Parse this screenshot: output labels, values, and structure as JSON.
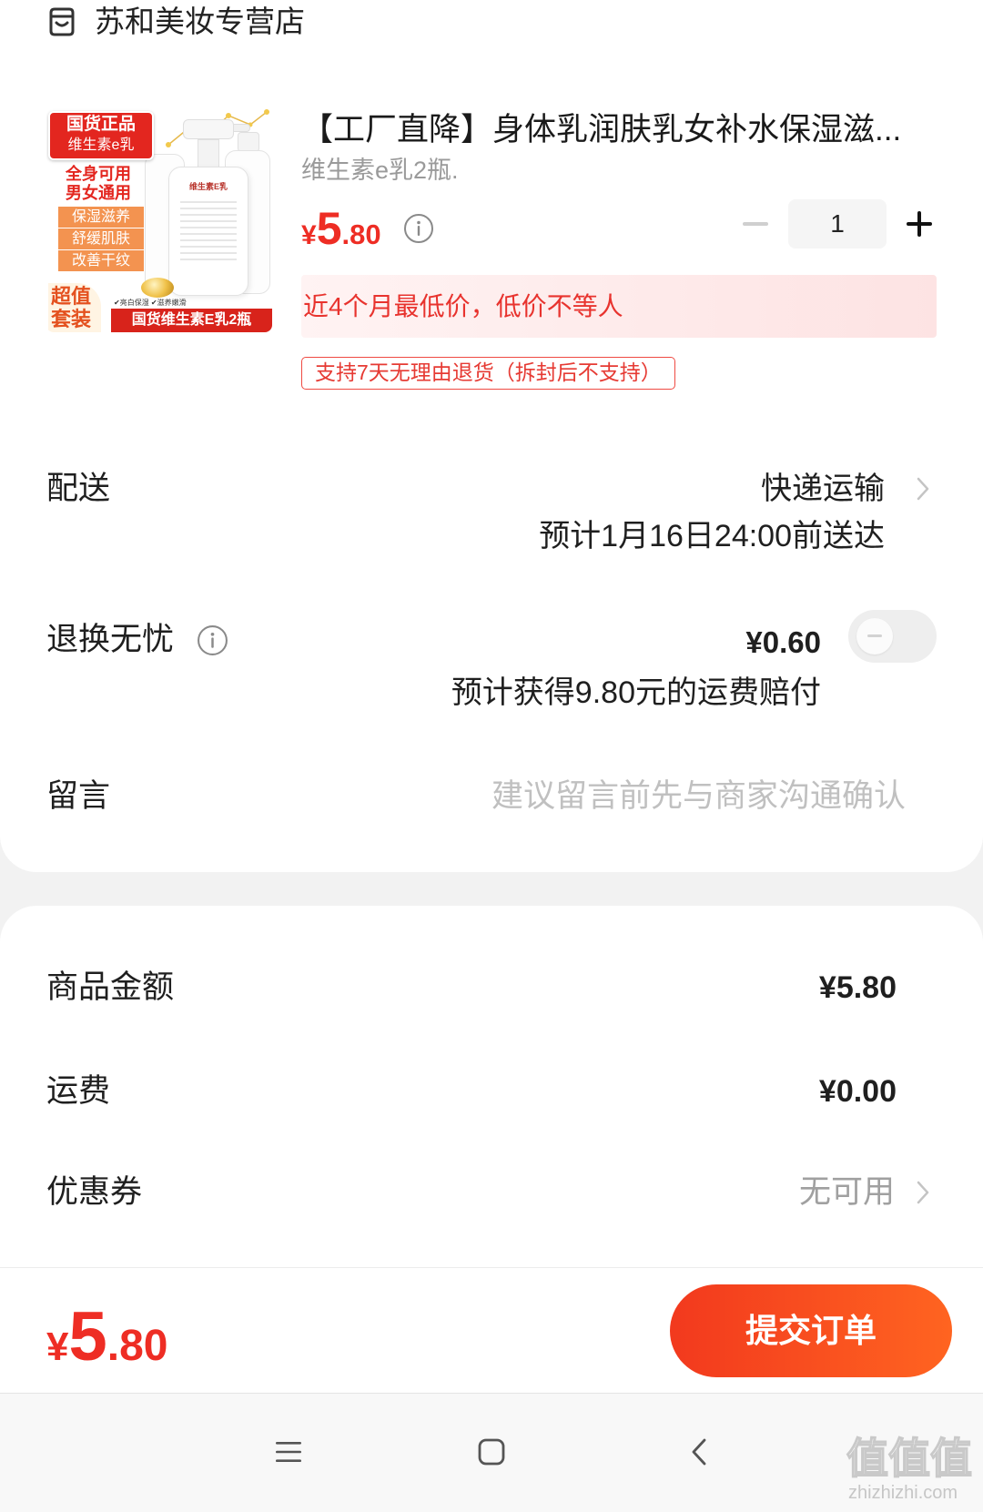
{
  "store": {
    "name": "苏和美妆专营店",
    "icon": "store-icon"
  },
  "product": {
    "title": "【工厂直降】身体乳润肤乳女补水保湿滋...",
    "spec": "维生素e乳2瓶.",
    "price": {
      "symbol": "¥",
      "integer": "5",
      "decimal": ".80"
    },
    "quantity": "1",
    "promo_banner": "近4个月最低价，低价不等人",
    "return_tag": "支持7天无理由退货（拆封后不支持）",
    "image": {
      "badge_line1": "国货正品",
      "badge_line2": "维生素e乳",
      "usage_line1": "全身可用",
      "usage_line2": "男女通用",
      "benefits": [
        "保湿滋养",
        "舒缓肌肤",
        "改善干纹"
      ],
      "bundle_line1": "超值",
      "bundle_line2": "套装",
      "checks": "✔亮白保湿 ✔滋养嫩滑",
      "bottom_banner": "国货维生素E乳2瓶",
      "bottle_label": "维生素E乳"
    }
  },
  "delivery": {
    "label": "配送",
    "method": "快递运输",
    "eta": "预计1月16日24:00前送达"
  },
  "return_insurance": {
    "label": "退换无忧",
    "price": "¥0.60",
    "note": "预计获得9.80元的运费赔付",
    "enabled": false
  },
  "message": {
    "label": "留言",
    "placeholder": "建议留言前先与商家沟通确认"
  },
  "summary": {
    "rows": [
      {
        "label": "商品金额",
        "value": "¥5.80"
      },
      {
        "label": "运费",
        "value": "¥0.00"
      },
      {
        "label": "优惠券",
        "value": "无可用"
      }
    ]
  },
  "footer": {
    "total": {
      "symbol": "¥",
      "integer": "5",
      "decimal": ".80"
    },
    "submit_label": "提交订单"
  },
  "nav": {
    "icons": [
      "menu-icon",
      "home-icon",
      "back-icon"
    ]
  },
  "watermark": {
    "mark": "值值值",
    "site": "zhizhizhi.com"
  },
  "colors": {
    "accent_red": "#ee2d24",
    "promo_text": "#e8332e",
    "button_gradient_start": "#f2391e",
    "button_gradient_end": "#ff6420",
    "page_background": "#f2f2f2"
  }
}
